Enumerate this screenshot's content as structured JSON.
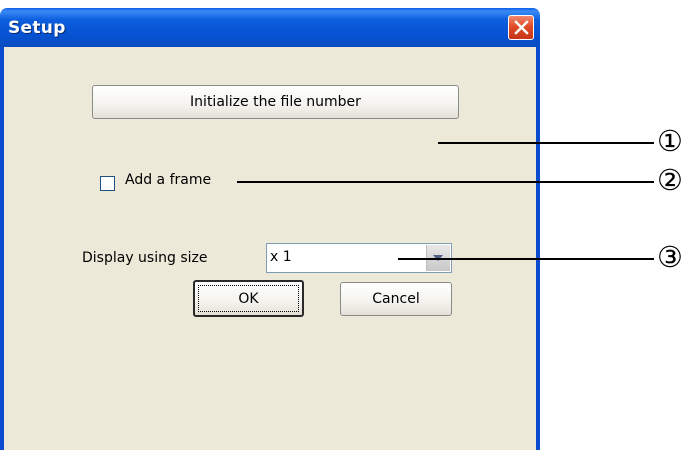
{
  "window": {
    "title": "Setup"
  },
  "buttons": {
    "initialize_label": "Initialize the file number",
    "ok_label": "OK",
    "cancel_label": "Cancel"
  },
  "frame_option": {
    "label": "Add a frame",
    "checked": false
  },
  "display_size": {
    "label": "Display using size",
    "selected_value": "x 1"
  },
  "callouts": [
    "①",
    "②",
    "③"
  ],
  "colors": {
    "titlebar": "#0a5fe8",
    "close_button": "#e04c26",
    "dialog_background": "#ece9d8"
  },
  "icons": {
    "close": "close-x-icon",
    "dropdown": "dropdown-arrow-icon"
  }
}
